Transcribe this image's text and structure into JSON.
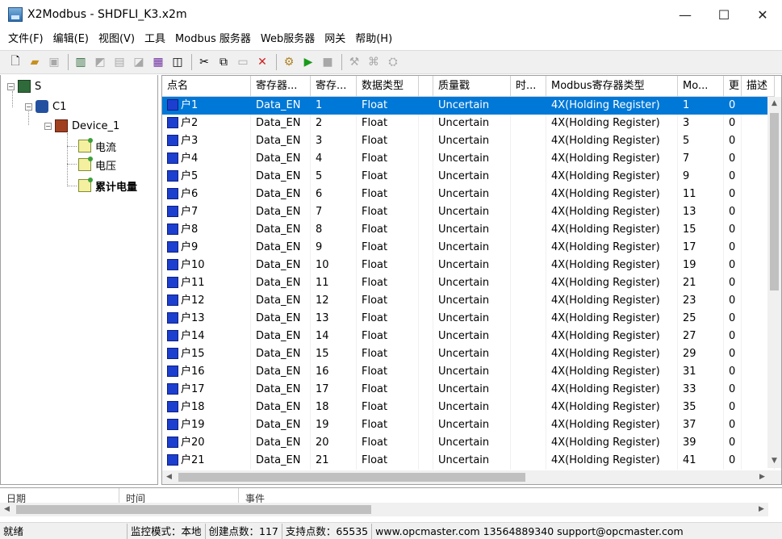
{
  "window": {
    "title": "X2Modbus - SHDFLI_K3.x2m",
    "minimize": "—",
    "maximize": "☐",
    "close": "✕"
  },
  "menu": [
    "文件(F)",
    "编辑(E)",
    "视图(V)",
    "工具",
    "Modbus 服务器",
    "Web服务器",
    "网关",
    "帮助(H)"
  ],
  "toolbar": {
    "icons": [
      "new-file-icon",
      "open-folder-icon",
      "save-icon",
      "add-channel-icon",
      "add-device-icon",
      "add-group-icon",
      "add-point-icon",
      "batch-add-icon",
      "properties-icon",
      "cut-icon",
      "copy-icon",
      "paste-icon",
      "delete-icon",
      "config-icon",
      "run-icon",
      "stop-icon",
      "tool-icon",
      "tool2-icon",
      "tool3-icon"
    ]
  },
  "tree": {
    "root": "S",
    "channel": "C1",
    "device": "Device_1",
    "groups": [
      "电流",
      "电压",
      "累计电量"
    ]
  },
  "table": {
    "columns": [
      "点名",
      "寄存器...",
      "寄存...",
      "数据类型",
      "",
      "质量戳",
      "时...",
      "Modbus寄存器类型",
      "Mo...",
      "更",
      "描述"
    ],
    "rows": [
      [
        "户1",
        "Data_EN",
        "1",
        "Float",
        "",
        "Uncertain",
        "",
        "4X(Holding Register)",
        "1",
        "0",
        ""
      ],
      [
        "户2",
        "Data_EN",
        "2",
        "Float",
        "",
        "Uncertain",
        "",
        "4X(Holding Register)",
        "3",
        "0",
        ""
      ],
      [
        "户3",
        "Data_EN",
        "3",
        "Float",
        "",
        "Uncertain",
        "",
        "4X(Holding Register)",
        "5",
        "0",
        ""
      ],
      [
        "户4",
        "Data_EN",
        "4",
        "Float",
        "",
        "Uncertain",
        "",
        "4X(Holding Register)",
        "7",
        "0",
        ""
      ],
      [
        "户5",
        "Data_EN",
        "5",
        "Float",
        "",
        "Uncertain",
        "",
        "4X(Holding Register)",
        "9",
        "0",
        ""
      ],
      [
        "户6",
        "Data_EN",
        "6",
        "Float",
        "",
        "Uncertain",
        "",
        "4X(Holding Register)",
        "11",
        "0",
        ""
      ],
      [
        "户7",
        "Data_EN",
        "7",
        "Float",
        "",
        "Uncertain",
        "",
        "4X(Holding Register)",
        "13",
        "0",
        ""
      ],
      [
        "户8",
        "Data_EN",
        "8",
        "Float",
        "",
        "Uncertain",
        "",
        "4X(Holding Register)",
        "15",
        "0",
        ""
      ],
      [
        "户9",
        "Data_EN",
        "9",
        "Float",
        "",
        "Uncertain",
        "",
        "4X(Holding Register)",
        "17",
        "0",
        ""
      ],
      [
        "户10",
        "Data_EN",
        "10",
        "Float",
        "",
        "Uncertain",
        "",
        "4X(Holding Register)",
        "19",
        "0",
        ""
      ],
      [
        "户11",
        "Data_EN",
        "11",
        "Float",
        "",
        "Uncertain",
        "",
        "4X(Holding Register)",
        "21",
        "0",
        ""
      ],
      [
        "户12",
        "Data_EN",
        "12",
        "Float",
        "",
        "Uncertain",
        "",
        "4X(Holding Register)",
        "23",
        "0",
        ""
      ],
      [
        "户13",
        "Data_EN",
        "13",
        "Float",
        "",
        "Uncertain",
        "",
        "4X(Holding Register)",
        "25",
        "0",
        ""
      ],
      [
        "户14",
        "Data_EN",
        "14",
        "Float",
        "",
        "Uncertain",
        "",
        "4X(Holding Register)",
        "27",
        "0",
        ""
      ],
      [
        "户15",
        "Data_EN",
        "15",
        "Float",
        "",
        "Uncertain",
        "",
        "4X(Holding Register)",
        "29",
        "0",
        ""
      ],
      [
        "户16",
        "Data_EN",
        "16",
        "Float",
        "",
        "Uncertain",
        "",
        "4X(Holding Register)",
        "31",
        "0",
        ""
      ],
      [
        "户17",
        "Data_EN",
        "17",
        "Float",
        "",
        "Uncertain",
        "",
        "4X(Holding Register)",
        "33",
        "0",
        ""
      ],
      [
        "户18",
        "Data_EN",
        "18",
        "Float",
        "",
        "Uncertain",
        "",
        "4X(Holding Register)",
        "35",
        "0",
        ""
      ],
      [
        "户19",
        "Data_EN",
        "19",
        "Float",
        "",
        "Uncertain",
        "",
        "4X(Holding Register)",
        "37",
        "0",
        ""
      ],
      [
        "户20",
        "Data_EN",
        "20",
        "Float",
        "",
        "Uncertain",
        "",
        "4X(Holding Register)",
        "39",
        "0",
        ""
      ],
      [
        "户21",
        "Data_EN",
        "21",
        "Float",
        "",
        "Uncertain",
        "",
        "4X(Holding Register)",
        "41",
        "0",
        ""
      ]
    ],
    "selected_row": 0
  },
  "log": {
    "columns": [
      "日期",
      "时间",
      "事件"
    ]
  },
  "status": {
    "ready": "就绪",
    "mode": "监控模式：本地",
    "created": "创建点数：117",
    "supported": "支持点数：65535",
    "contact": "www.opcmaster.com 13564889340 support@opcmaster.com"
  },
  "colors": {
    "selection": "#0078d7",
    "point_icon": "#1d3fcf",
    "run": "#1a9a1a"
  }
}
